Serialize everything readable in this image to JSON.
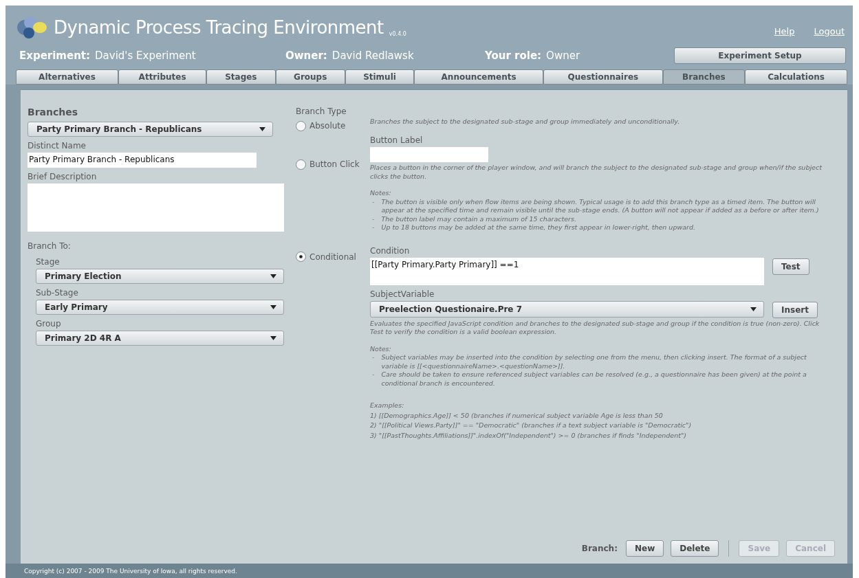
{
  "header": {
    "title": "Dynamic Process Tracing Environment",
    "version": "v0.4.0",
    "links": [
      "Help",
      "Logout"
    ]
  },
  "info": [
    {
      "label": "Experiment:",
      "value": "David's Experiment"
    },
    {
      "label": "Owner:",
      "value": "David Redlawsk"
    },
    {
      "label": "Your role:",
      "value": "Owner"
    }
  ],
  "setup_button": "Experiment Setup",
  "tabs": [
    {
      "label": "Alternatives",
      "selected": false
    },
    {
      "label": "Attributes",
      "selected": false
    },
    {
      "label": "Stages",
      "selected": false
    },
    {
      "label": "Groups",
      "selected": false
    },
    {
      "label": "Stimuli",
      "selected": false
    },
    {
      "label": "Announcements",
      "selected": false
    },
    {
      "label": "Questionnaires",
      "selected": false
    },
    {
      "label": "Branches",
      "selected": true
    },
    {
      "label": "Calculations",
      "selected": false
    }
  ],
  "left": {
    "heading": "Branches",
    "branch_select": "Party Primary Branch - Republicans",
    "distinct_name_label": "Distinct Name",
    "distinct_name": "Party Primary Branch - Republicans",
    "description_label": "Brief Description",
    "branch_to_label": "Branch To:",
    "targets": [
      {
        "label": "Stage",
        "value": "Primary Election"
      },
      {
        "label": "Sub-Stage",
        "value": "Early Primary"
      },
      {
        "label": "Group",
        "value": "Primary 2D 4R A"
      }
    ]
  },
  "branch_type": {
    "heading": "Branch Type",
    "options": [
      {
        "kind": "absolute",
        "label": "Absolute",
        "selected": false
      },
      {
        "kind": "button",
        "label": "Button Click",
        "selected": false
      },
      {
        "kind": "conditional",
        "label": "Conditional",
        "selected": true
      }
    ]
  },
  "absolute": {
    "description": "Branches the subject to the designated sub-stage and group immediately and unconditionally."
  },
  "button_click": {
    "field_label": "Button Label",
    "description": "Places a button in the corner of the player window, and will branch the subject to the designated sub-stage and group when/if the subject clicks the button.",
    "notes_heading": "Notes:",
    "notes": [
      {
        "marker": "-",
        "text": "The button is visible only when flow items are being shown.  Typical usage is to add this branch type as a timed item.  The button will appear at the specified time and remain visible until the sub-stage ends.  (A button will not appear if added as a before or after item.)"
      },
      {
        "marker": "-",
        "text": "The button label may contain a maximum of 15 characters."
      },
      {
        "marker": "-",
        "text": "Up to 18 buttons may be added at the same time, they first appear in lower-right, then upward."
      }
    ]
  },
  "conditional": {
    "condition_label": "Condition",
    "condition": "[[Party Primary.Party Primary]] ==1",
    "test_button": "Test",
    "variable_label": "SubjectVariable",
    "variable": "Preelection Questionaire.Pre 7",
    "insert_button": "Insert",
    "description": "Evaluates the specified JavaScript condition and branches to the designated sub-stage and group if the condition is true (non-zero). Click Test to verify the condition is a valid boolean expression.",
    "notes_heading": "Notes:",
    "notes": [
      {
        "marker": "-",
        "text": "Subject variables may be inserted into the condition by selecting one from the menu, then clicking insert.  The format of a subject variable is [[<questionnaireName>.<questionName>]]."
      },
      {
        "marker": "-",
        "text": "Care should be taken to ensure referenced subject variables can be resolved (e.g., a questionnaire has been given) at the point a conditional branch is encountered."
      }
    ],
    "examples_heading": "Examples:",
    "examples": [
      "1) [[Demographics.Age]] < 50 (branches if numerical subject variable Age is less than 50",
      "2) \"[[Political Views.Party]]\" == \"Democratic\" (branches if a text subject variable is \"Democratic\")",
      "3) \"[[PastThoughts.Affiliations]]\".indexOf(\"Independent\") >= 0 (branches if finds \"Independent\")"
    ]
  },
  "actions": {
    "label": "Branch:",
    "buttons": [
      {
        "label": "New",
        "disabled": false
      },
      {
        "label": "Delete",
        "disabled": false
      },
      {
        "label": "Save",
        "disabled": true
      },
      {
        "label": "Cancel",
        "disabled": true
      }
    ]
  },
  "copyright": "Copyright (c) 2007 - 2009 The University of Iowa, all rights reserved."
}
